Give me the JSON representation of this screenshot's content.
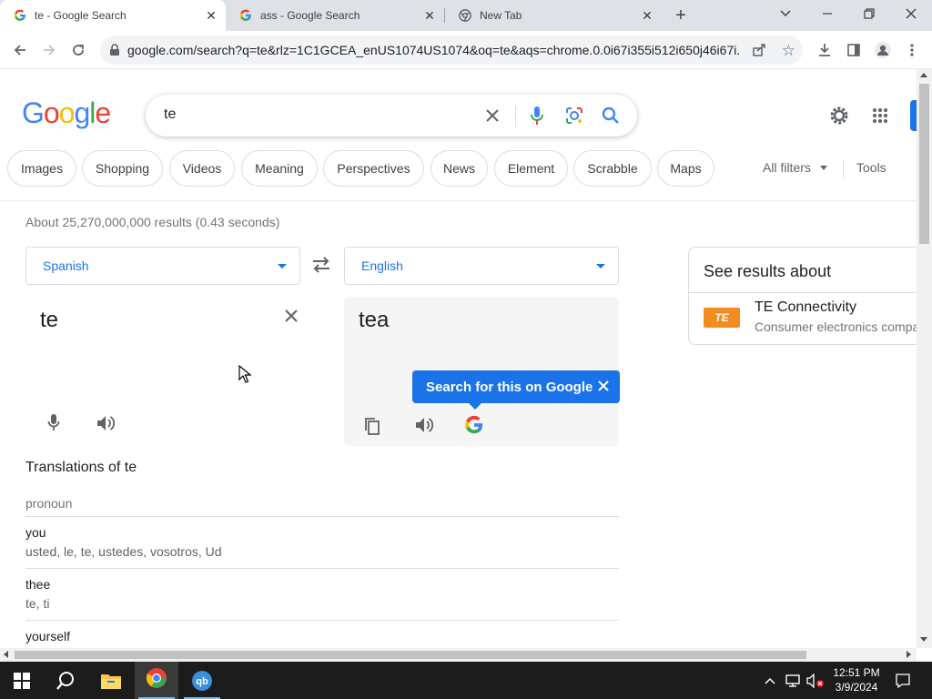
{
  "browser": {
    "tabs": [
      {
        "title": "te - Google Search",
        "active": true
      },
      {
        "title": "ass - Google Search",
        "active": false
      },
      {
        "title": "New Tab",
        "active": false
      }
    ],
    "url": "google.com/search?q=te&rlz=1C1GCEA_enUS1074US1074&oq=te&aqs=chrome.0.0i67i355i512i650j46i67i..."
  },
  "search": {
    "query": "te",
    "logo": "Google"
  },
  "chips": [
    "Images",
    "Shopping",
    "Videos",
    "Meaning",
    "Perspectives",
    "News",
    "Element",
    "Scrabble",
    "Maps"
  ],
  "filters": {
    "all_filters": "All filters",
    "tools": "Tools"
  },
  "stats": "About 25,270,000,000 results (0.43 seconds)",
  "translate": {
    "source_lang": "Spanish",
    "target_lang": "English",
    "source_text": "te",
    "target_text": "tea",
    "tooltip": "Search for this on Google",
    "translations_title": "Translations of te",
    "part_of_speech": "pronoun",
    "entries": [
      {
        "word": "you",
        "synonyms": "usted, le, te, ustedes, vosotros, Ud"
      },
      {
        "word": "thee",
        "synonyms": "te, ti"
      },
      {
        "word": "yourself",
        "synonyms": ""
      }
    ]
  },
  "knowledge": {
    "title": "See results about",
    "entity_name": "TE Connectivity",
    "entity_desc": "Consumer electronics compa",
    "logo_text": "TE"
  },
  "taskbar": {
    "time": "12:51 PM",
    "date": "3/9/2024"
  },
  "colors": {
    "google_blue": "#4285f4",
    "google_red": "#ea4335",
    "google_yellow": "#fbbc05",
    "google_green": "#34a853",
    "link_blue": "#1a73e8",
    "te_orange": "#f28c1f"
  },
  "icons": [
    "google-g-icon",
    "chrome-icon",
    "close-icon",
    "plus-icon",
    "chevron-down-icon",
    "minimize-icon",
    "restore-icon",
    "back-icon",
    "forward-icon",
    "reload-icon",
    "lock-icon",
    "share-icon",
    "star-icon",
    "download-icon",
    "sidepanel-icon",
    "profile-icon",
    "menu-icon",
    "mic-icon",
    "lens-icon",
    "search-icon",
    "gear-icon",
    "apps-icon",
    "swap-icon",
    "speaker-icon",
    "copy-icon",
    "windows-icon",
    "search-taskbar-icon",
    "folder-icon",
    "qbittorrent-icon",
    "notification-icon"
  ]
}
